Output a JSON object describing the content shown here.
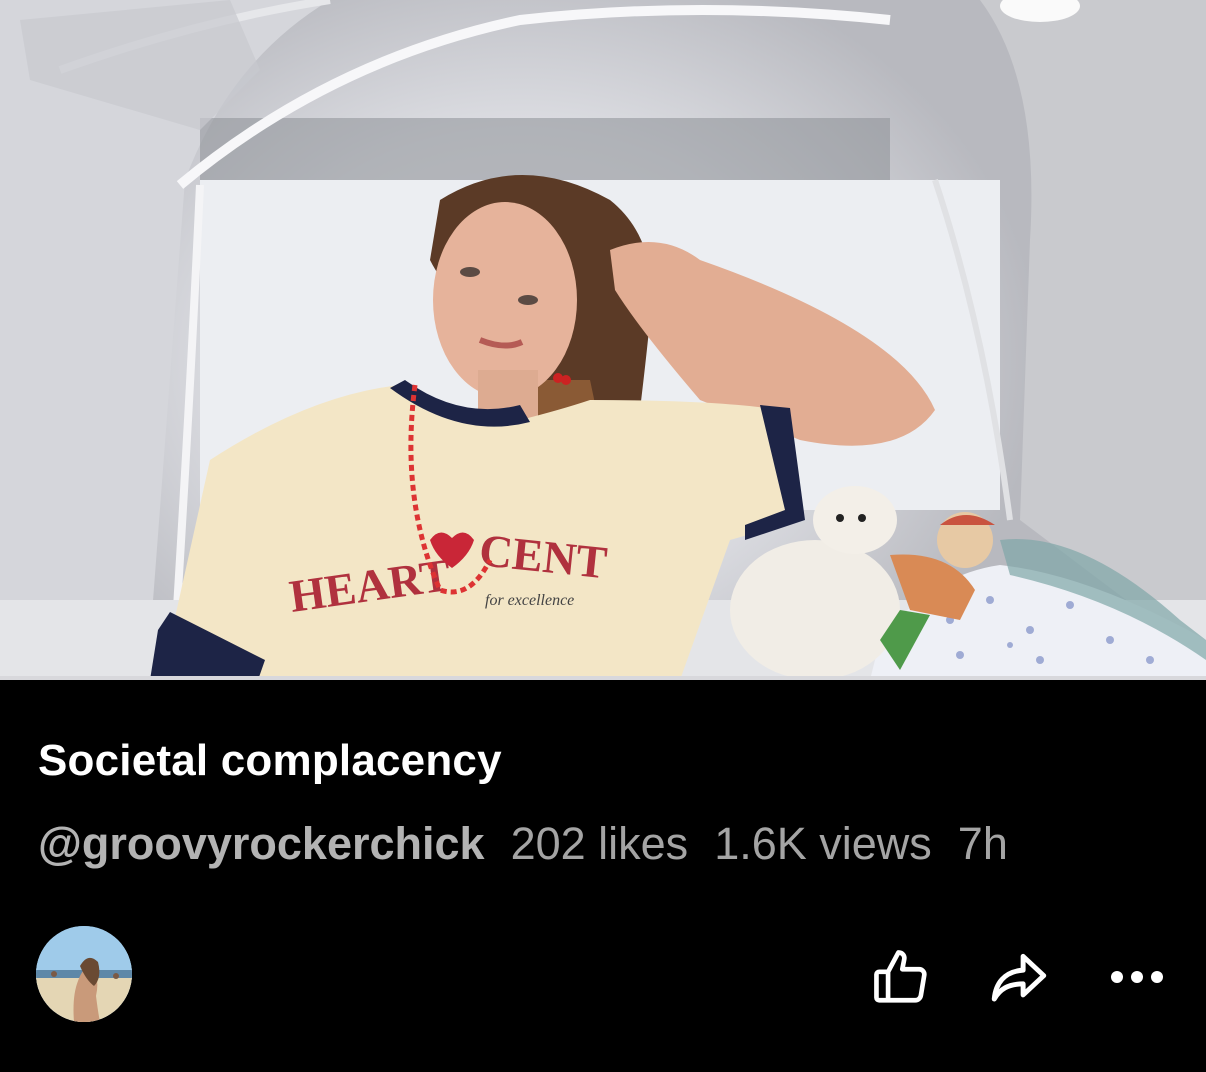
{
  "video": {
    "title": "Societal complacency",
    "channel_handle": "@groovyrockerchick",
    "likes": "202 likes",
    "views": "1.6K views",
    "age": "7h"
  },
  "actions": {
    "like_icon": "thumbs-up-icon",
    "share_icon": "share-arrow-icon",
    "more_icon": "more-horizontal-icon"
  },
  "colors": {
    "background": "#000000",
    "title": "#ffffff",
    "meta": "#a4a4a4"
  }
}
